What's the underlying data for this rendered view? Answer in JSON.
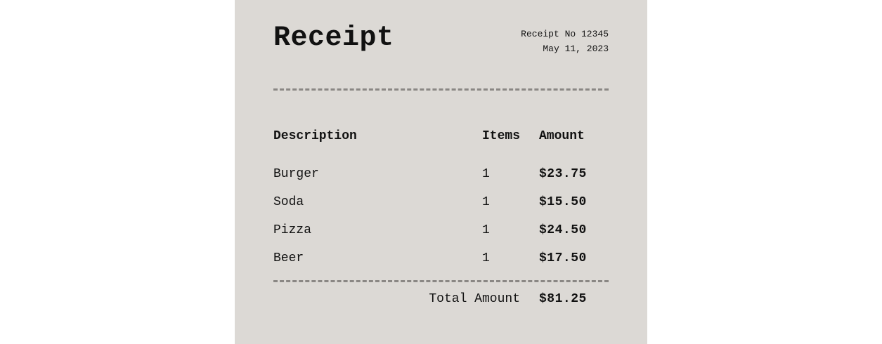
{
  "receipt": {
    "title": "Receipt",
    "number": "Receipt No 12345",
    "date": "May 11, 2023"
  },
  "table": {
    "headers": {
      "description": "Description",
      "items": "Items",
      "amount": "Amount"
    },
    "rows": [
      {
        "description": "Burger",
        "items": "1",
        "amount": "$23.75"
      },
      {
        "description": "Soda",
        "items": "1",
        "amount": "$15.50"
      },
      {
        "description": "Pizza",
        "items": "1",
        "amount": "$24.50"
      },
      {
        "description": "Beer",
        "items": "1",
        "amount": "$17.50"
      }
    ]
  },
  "total": {
    "label": "Total Amount",
    "value": "$81.25"
  },
  "colors": {
    "paper": "#dcd9d5",
    "text": "#111111",
    "divider": "#8a8784"
  }
}
